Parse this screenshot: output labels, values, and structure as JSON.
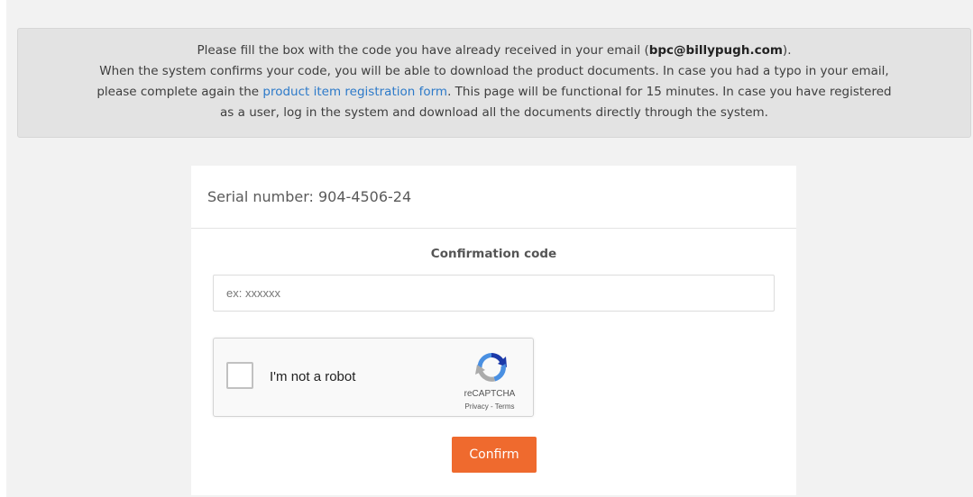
{
  "notice": {
    "line1_prefix": "Please fill the box with the code you have already received in your email (",
    "email": "bpc@billypugh.com",
    "line1_suffix": ").",
    "line2": "When the system confirms your code, you will be able to download the product documents. In case you had a typo in your email,",
    "line3_prefix": "please complete again the ",
    "link_text": "product item registration form",
    "line3_suffix": ". This page will be functional for 15 minutes. In case you have registered",
    "line4": "as a user, log in the system and download all the documents directly through the system."
  },
  "card": {
    "serial_label": "Serial number: 904-4506-24",
    "code_label": "Confirmation code",
    "code_placeholder": "ex: xxxxxx",
    "code_value": ""
  },
  "recaptcha": {
    "label": "I'm not a robot",
    "brand": "reCAPTCHA",
    "privacy": "Privacy",
    "separator": " - ",
    "terms": "Terms",
    "icon": "recaptcha-logo-icon"
  },
  "confirm_label": "Confirm",
  "colors": {
    "accent": "#ef6a2e",
    "link": "#2d7ac9",
    "notice_bg": "#e3e3e3"
  }
}
